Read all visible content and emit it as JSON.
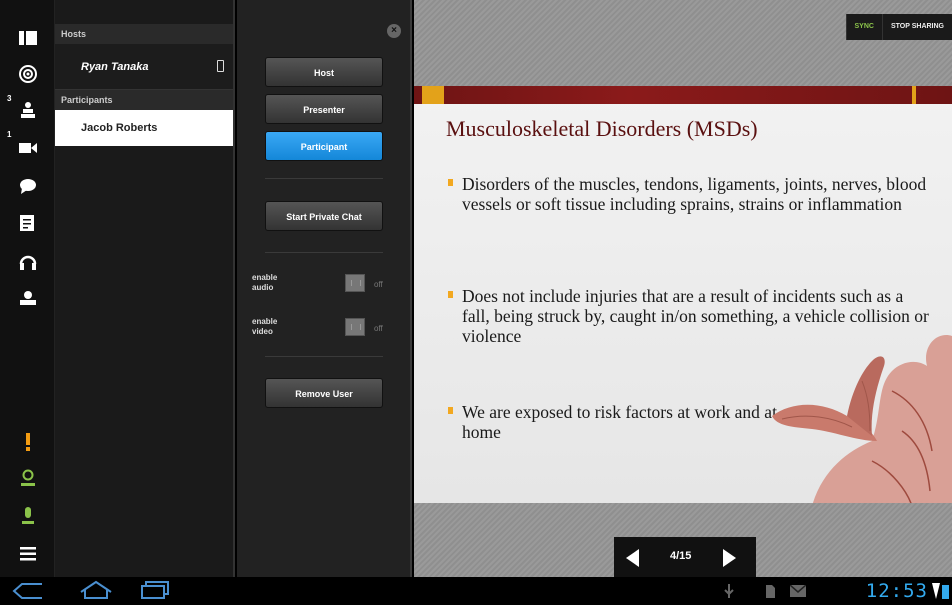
{
  "people_panel": {
    "hosts_header": "Hosts",
    "host_name": "Ryan Tanaka",
    "participants_header": "Participants",
    "participant_name": "Jacob Roberts"
  },
  "rail": {
    "participant_count": "3",
    "video_count": "1",
    "icons": [
      "grid-icon",
      "target-icon",
      "people-icon",
      "video-camera-icon",
      "chat-icon",
      "notes-icon",
      "headset-icon",
      "share-icon",
      "alert-icon",
      "user-status-icon",
      "microphone-icon",
      "menu-icon"
    ]
  },
  "actions": {
    "close_label": "×",
    "host_label": "Host",
    "presenter_label": "Presenter",
    "participant_label": "Participant",
    "private_chat_label": "Start Private Chat",
    "audio_label_1": "enable",
    "audio_label_2": "audio",
    "audio_state": "off",
    "video_label_1": "enable",
    "video_label_2": "video",
    "video_state": "off",
    "remove_label": "Remove User",
    "selected_role": "Participant"
  },
  "topbar": {
    "sync_label": "SYNC",
    "stop_label": "STOP SHARING"
  },
  "slide": {
    "title": "Musculoskeletal Disorders (MSDs)",
    "bullets": [
      "Disorders of the muscles, tendons, ligaments, joints, nerves, blood vessels or soft tissue including sprains, strains or inflammation",
      "Does not include injuries that are a result of incidents such as a fall, being struck by, caught in/on something, a vehicle collision or violence",
      "We are exposed to risk factors at work and at home"
    ]
  },
  "pager": {
    "current": 4,
    "total": 15,
    "label": "4/15"
  },
  "sysbar": {
    "time": "12:53"
  },
  "colors": {
    "accent": "#1a8fe0",
    "sync": "#8bc34a",
    "slide_title": "#5a1010",
    "clock": "#33aaee"
  }
}
